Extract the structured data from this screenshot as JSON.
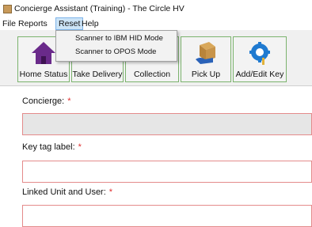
{
  "window": {
    "title": "Concierge Assistant (Training) - The Circle HV"
  },
  "menu": {
    "file": "File",
    "reports": "Reports",
    "reset": "Reset",
    "help": "Help"
  },
  "reset_menu": {
    "items": [
      "Scanner to IBM HID Mode",
      "Scanner to OPOS Mode"
    ]
  },
  "toolbar": {
    "buttons": [
      "Home Status",
      "Take Delivery",
      "Collection",
      "Pick Up",
      "Add/Edit Key"
    ]
  },
  "form": {
    "concierge_label": "Concierge:",
    "key_tag_label": "Key tag label:",
    "linked_unit_label": "Linked Unit and User:",
    "required_marker": "*"
  },
  "colors": {
    "required": "#e03030",
    "field_border": "#e48b8b",
    "button_border": "#7bb36d",
    "menu_highlight": "#cce4f7"
  }
}
